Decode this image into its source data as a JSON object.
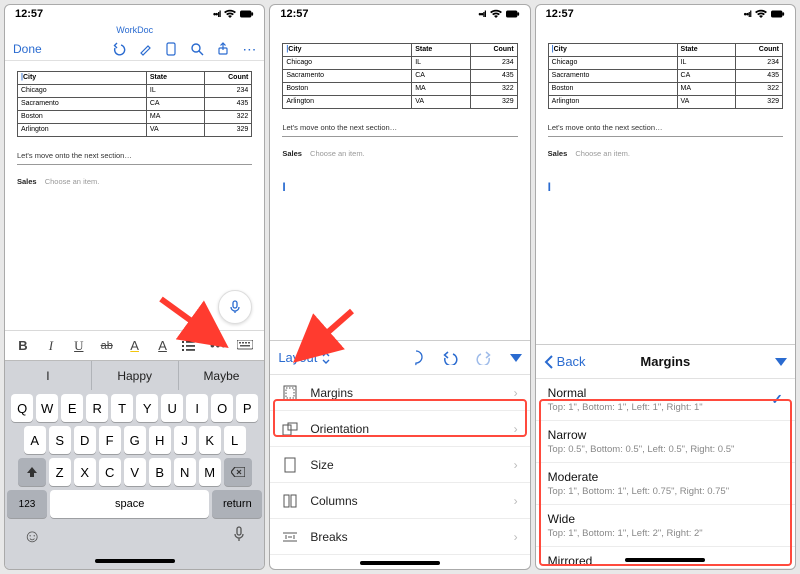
{
  "status": {
    "time": "12:57"
  },
  "toolbar": {
    "done": "Done",
    "title": "WorkDoc"
  },
  "document": {
    "table": {
      "headers": [
        "City",
        "State",
        "Count"
      ],
      "rows": [
        [
          "Chicago",
          "IL",
          "234"
        ],
        [
          "Sacramento",
          "CA",
          "435"
        ],
        [
          "Boston",
          "MA",
          "322"
        ],
        [
          "Arlington",
          "VA",
          "329"
        ]
      ]
    },
    "paragraph": "Let's move onto the next section…",
    "sales_label": "Sales",
    "sales_placeholder": "Choose an item."
  },
  "format_icons": [
    "B",
    "I",
    "U",
    "ab",
    "A",
    "A",
    "list",
    "dots",
    "kb"
  ],
  "predictions": [
    "I",
    "Happy",
    "Maybe"
  ],
  "keyboard": {
    "row1": [
      "Q",
      "W",
      "E",
      "R",
      "T",
      "Y",
      "U",
      "I",
      "O",
      "P"
    ],
    "row2": [
      "A",
      "S",
      "D",
      "F",
      "G",
      "H",
      "J",
      "K",
      "L"
    ],
    "row3": [
      "Z",
      "X",
      "C",
      "V",
      "B",
      "N",
      "M"
    ],
    "k123": "123",
    "space": "space",
    "ret": "return"
  },
  "layout_panel": {
    "title": "Layout",
    "items": [
      {
        "icon": "margins",
        "label": "Margins"
      },
      {
        "icon": "orientation",
        "label": "Orientation"
      },
      {
        "icon": "size",
        "label": "Size"
      },
      {
        "icon": "columns",
        "label": "Columns"
      },
      {
        "icon": "breaks",
        "label": "Breaks"
      }
    ]
  },
  "margins_panel": {
    "back": "Back",
    "title": "Margins",
    "options": [
      {
        "name": "Normal",
        "desc": "Top: 1\", Bottom: 1\", Left: 1\", Right: 1\"",
        "selected": true
      },
      {
        "name": "Narrow",
        "desc": "Top: 0.5\", Bottom: 0.5\", Left: 0.5\", Right: 0.5\"",
        "selected": false
      },
      {
        "name": "Moderate",
        "desc": "Top: 1\", Bottom: 1\", Left: 0.75\", Right: 0.75\"",
        "selected": false
      },
      {
        "name": "Wide",
        "desc": "Top: 1\", Bottom: 1\", Left: 2\", Right: 2\"",
        "selected": false
      },
      {
        "name": "Mirrored",
        "desc": "",
        "selected": false
      }
    ]
  }
}
